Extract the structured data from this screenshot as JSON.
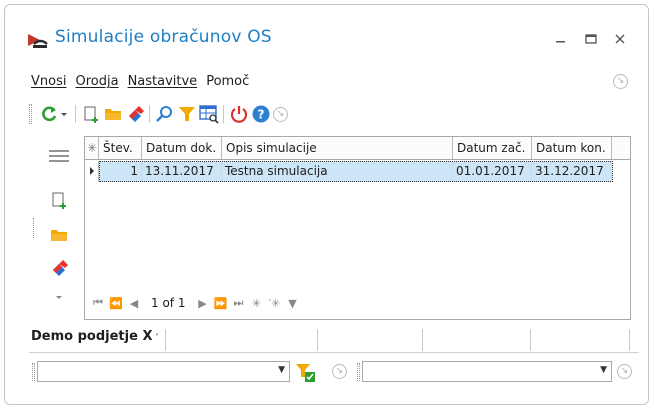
{
  "window": {
    "title": "Simulacije obračunov OS"
  },
  "menu": {
    "items": [
      "Vnosi",
      "Orodja",
      "Nastavitve",
      "Pomoč"
    ]
  },
  "grid": {
    "columns": [
      "Štev.",
      "Datum dok.",
      "Opis simulacije",
      "Datum zač.",
      "Datum kon."
    ],
    "rows": [
      {
        "stev": "1",
        "datum_dok": "13.11.2017",
        "opis": "Testna simulacija",
        "datum_zac": "01.01.2017",
        "datum_kon": "31.12.2017"
      }
    ],
    "navigator": {
      "position": "1 of 1"
    }
  },
  "tabs": {
    "active": "Demo podjetje X"
  },
  "filters": {
    "left_value": "",
    "right_value": ""
  },
  "colors": {
    "title": "#1e7fc4",
    "selected_row": "#cde6f7",
    "refresh": "#2e9e2e",
    "power": "#d9342b",
    "help": "#2f7fd0",
    "filter": "#f2a900"
  },
  "icons": [
    "app-icon",
    "refresh-icon",
    "new-doc-icon",
    "open-folder-icon",
    "eraser-icon",
    "search-icon",
    "filter-icon",
    "table-search-icon",
    "power-icon",
    "help-icon",
    "expand-icon",
    "hamburger-icon",
    "filter-apply-icon"
  ]
}
